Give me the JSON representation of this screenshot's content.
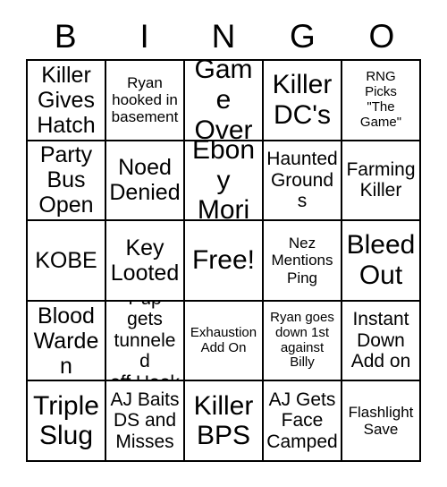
{
  "card": {
    "header_letters": [
      "B",
      "I",
      "N",
      "G",
      "O"
    ],
    "free_space_index": 12,
    "colors": {
      "grid_line": "#000000",
      "text": "#000000",
      "background": "#ffffff"
    },
    "cells": [
      {
        "text": "Killer\nGives\nHatch",
        "size": "lg"
      },
      {
        "text": "Ryan\nhooked in\nbasement",
        "size": "sm"
      },
      {
        "text": "Game\nOver",
        "size": "xl"
      },
      {
        "text": "Killer\nDC's",
        "size": "xl"
      },
      {
        "text": "RNG\nPicks\n\"The\nGame\"",
        "size": "xs"
      },
      {
        "text": "Party\nBus\nOpen",
        "size": "lg"
      },
      {
        "text": "Noed\nDenied",
        "size": "lg"
      },
      {
        "text": "Ebony\nMori",
        "size": "xl"
      },
      {
        "text": "Haunted\nGrounds",
        "size": "md"
      },
      {
        "text": "Farming\nKiller",
        "size": "md"
      },
      {
        "text": "KOBE",
        "size": "lg"
      },
      {
        "text": "Key\nLooted",
        "size": "lg"
      },
      {
        "text": "Free!",
        "size": "xl"
      },
      {
        "text": "Nez\nMentions\nPing",
        "size": "sm"
      },
      {
        "text": "Bleed\nOut",
        "size": "xl"
      },
      {
        "text": "Blood\nWarden",
        "size": "lg"
      },
      {
        "text": "Pup gets\ntunneled\noff Hook",
        "size": "md"
      },
      {
        "text": "Exhaustion\nAdd On",
        "size": "xs"
      },
      {
        "text": "Ryan goes\ndown 1st\nagainst\nBilly",
        "size": "xs"
      },
      {
        "text": "Instant\nDown\nAdd on",
        "size": "md"
      },
      {
        "text": "Triple\nSlug",
        "size": "xl"
      },
      {
        "text": "AJ Baits\nDS and\nMisses",
        "size": "md"
      },
      {
        "text": "Killer\nBPS",
        "size": "xl"
      },
      {
        "text": "AJ Gets\nFace\nCamped",
        "size": "md"
      },
      {
        "text": "Flashlight\nSave",
        "size": "sm"
      }
    ]
  }
}
